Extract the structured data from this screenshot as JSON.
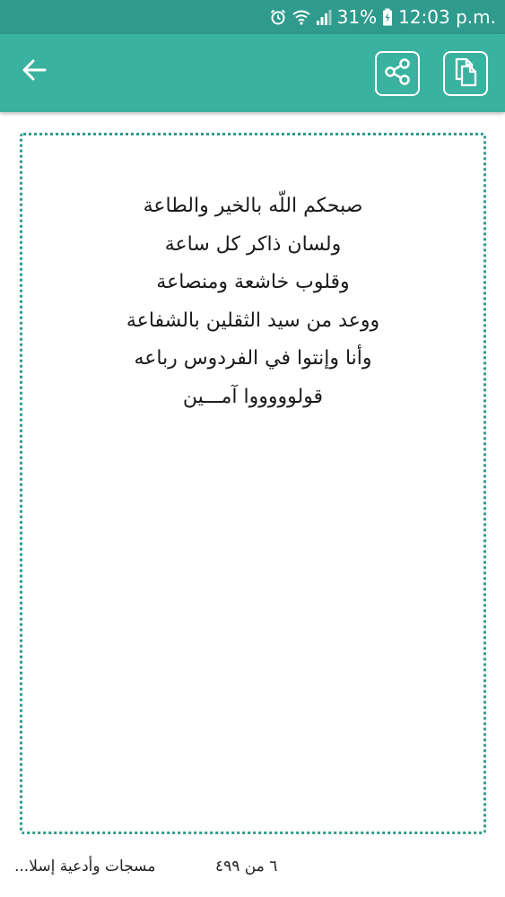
{
  "status_bar": {
    "battery": "31%",
    "time": "12:03 p.m."
  },
  "toolbar": {
    "back_icon": "arrow-left-icon",
    "share_icon": "share-icon",
    "copy_icon": "copy-icon"
  },
  "message": {
    "lines": [
      "صبحكم اللّه بالخير والطاعة",
      "ولسان ذاكر كل ساعة",
      "وقلوب خاشعة ومنصاعة",
      "ووعد من سيد الثقلين بالشفاعة",
      "وأنا وإنتوا في الفردوس رباعه",
      "قولوووووا آمـــين"
    ]
  },
  "footer": {
    "title": "مسجات وأدعية إسلا...",
    "counter": "٦ من ٤٩٩"
  },
  "colors": {
    "status_bar": "#2e9b8c",
    "app_bar": "#39b39f",
    "card_border": "#2e9b8c"
  }
}
